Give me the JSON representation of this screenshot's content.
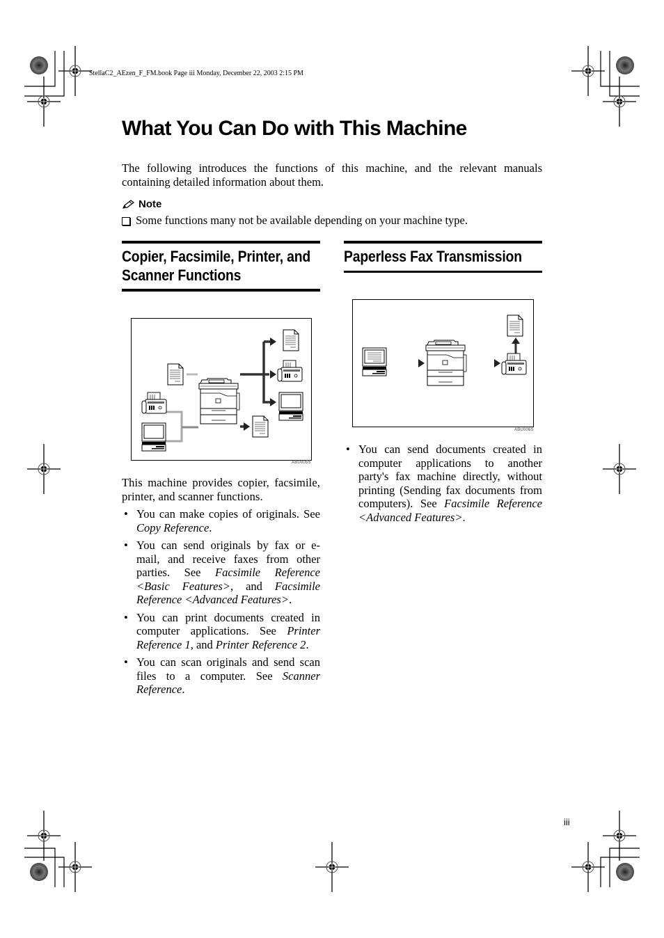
{
  "header": {
    "print_info": "StellaC2_AEzen_F_FM.book  Page iii  Monday, December 22, 2003  2:15 PM"
  },
  "title": "What You Can Do with This Machine",
  "intro": "The following introduces the functions of this machine, and the relevant manuals containing detailed information about them.",
  "note": {
    "icon": "pencil-icon",
    "label": "Note",
    "item_icon": "checkbox-icon",
    "item": "Some functions many not be available depending on your machine type."
  },
  "sections": [
    {
      "title_line1": "Copier, Facsimile, Printer, and",
      "title_line2": "Scanner Functions",
      "figure_code": "ABU005S",
      "figure_icons": [
        "document-icon",
        "fax-icon",
        "computer-icon",
        "copier-icon",
        "document-icon",
        "fax-icon",
        "computer-icon",
        "document-icon"
      ],
      "intro": "This machine provides copier, facsimile, printer, and scanner functions.",
      "bullets": [
        {
          "text": "You can make copies of originals. See ",
          "ref": "Copy Reference",
          "after": "."
        },
        {
          "text": "You can send originals by fax or e-mail, and receive faxes from other parties. See ",
          "ref": "Facsimile Reference <Basic Features>",
          "mid": ", and ",
          "ref2": "Facsimile Reference <Advanced Features>",
          "after": "."
        },
        {
          "text": "You can print documents created in computer applications. See ",
          "ref": "Printer Reference 1",
          "mid": ", and ",
          "ref2": "Printer Reference 2",
          "after": "."
        },
        {
          "text": "You can scan originals and send scan files to a computer. See ",
          "ref": "Scanner Reference",
          "after": "."
        }
      ]
    },
    {
      "title_line1": "Paperless Fax Transmission",
      "figure_code": "ABU006S",
      "figure_icons": [
        "computer-icon",
        "copier-icon",
        "fax-icon",
        "document-icon"
      ],
      "bullets": [
        {
          "text": "You can send documents created in computer applications to another party's fax machine directly, without printing (Sending fax documents from computers). See ",
          "ref": "Facsimile Reference <Advanced Features>",
          "after": "."
        }
      ]
    }
  ],
  "page_number": "iii",
  "bullet_glyph": "•"
}
